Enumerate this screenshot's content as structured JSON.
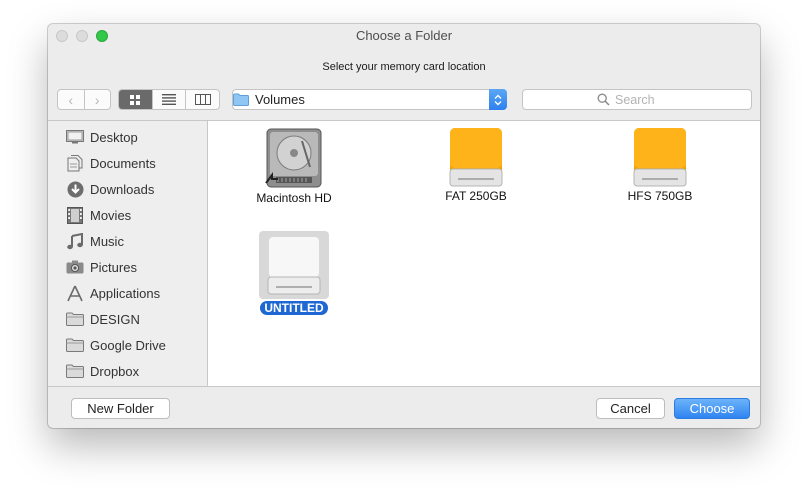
{
  "window": {
    "title": "Choose a Folder",
    "prompt": "Select your memory card location"
  },
  "toolbar": {
    "back_glyph": "‹",
    "forward_glyph": "›",
    "view_modes": [
      "icon-view",
      "list-view",
      "column-view"
    ],
    "active_view": "icon-view",
    "location": "Volumes",
    "search_placeholder": "Search"
  },
  "sidebar": {
    "items": [
      {
        "label": "Desktop",
        "icon": "desktop-icon"
      },
      {
        "label": "Documents",
        "icon": "documents-icon"
      },
      {
        "label": "Downloads",
        "icon": "downloads-icon"
      },
      {
        "label": "Movies",
        "icon": "movies-icon"
      },
      {
        "label": "Music",
        "icon": "music-icon"
      },
      {
        "label": "Pictures",
        "icon": "pictures-icon"
      },
      {
        "label": "Applications",
        "icon": "applications-icon"
      },
      {
        "label": "DESIGN",
        "icon": "folder-icon"
      },
      {
        "label": "Google Drive",
        "icon": "folder-icon"
      },
      {
        "label": "Dropbox",
        "icon": "folder-icon"
      }
    ]
  },
  "files": {
    "items": [
      {
        "label": "Macintosh HD",
        "icon": "internal-hard-drive-icon",
        "selected": false
      },
      {
        "label": "FAT 250GB",
        "icon": "external-drive-orange-icon",
        "selected": false
      },
      {
        "label": "HFS 750GB",
        "icon": "external-drive-orange-icon",
        "selected": false
      },
      {
        "label": "UNTITLED",
        "icon": "removable-drive-white-icon",
        "selected": true
      }
    ]
  },
  "footer": {
    "new_folder_label": "New Folder",
    "cancel_label": "Cancel",
    "choose_label": "Choose"
  },
  "colors": {
    "accent": "#2f84f0",
    "selection": "#1f67d2",
    "zoom_button": "#34c84a",
    "drive_orange": "#f5a300"
  }
}
